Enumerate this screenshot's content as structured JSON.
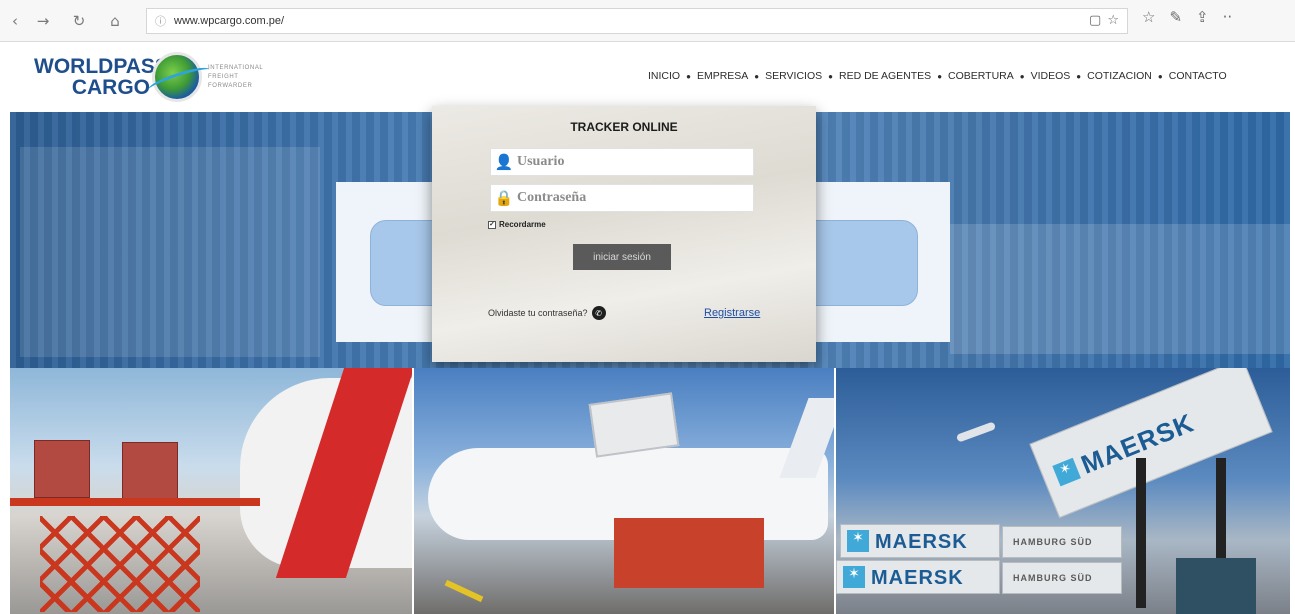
{
  "browser": {
    "back_icon": "‹",
    "forward_icon": "→",
    "refresh_icon": "↻",
    "home_icon": "⌂",
    "info_icon": "ⓘ",
    "url": "www.wpcargo.com.pe/",
    "reading_icon": "▢",
    "favorite_icon": "☆",
    "favorites_icon": "☆",
    "pen_icon": "✎",
    "share_icon": "⇪",
    "more_icon": "··"
  },
  "logo": {
    "line1": "WORLDPASS",
    "line2": "CARGO",
    "sub1": "INTERNATIONAL",
    "sub2": "FREIGHT",
    "sub3": "FORWARDER"
  },
  "nav": {
    "items": [
      "INICIO",
      "EMPRESA",
      "SERVICIOS",
      "RED DE AGENTES",
      "COBERTURA",
      "VIDEOS",
      "COTIZACION",
      "CONTACTO"
    ],
    "separator": "●"
  },
  "login": {
    "title": "TRACKER ONLINE",
    "username_placeholder": "Usuario",
    "password_placeholder": "Contraseña",
    "user_icon": "👤",
    "lock_icon": "🔒",
    "remember_label": "Recordarme",
    "remember_check": "✓",
    "submit_label": "iniciar sesión",
    "forgot_label": "Olvidaste tu contraseña?",
    "phone_icon": "✆",
    "register_label": "Registrarse"
  },
  "photos": {
    "maersk1": "MAERSK",
    "maersk2": "MAERSK",
    "maersk3": "MAERSK",
    "hamburg1": "HAMBURG SÜD",
    "hamburg2": "HAMBURG SÜD",
    "star_icon": "✶"
  },
  "colors": {
    "brand_blue": "#1f4e8c",
    "hero_blue": "#3f74ad",
    "link_blue": "#1e4fa8",
    "button_gray": "#5a5a5a"
  }
}
